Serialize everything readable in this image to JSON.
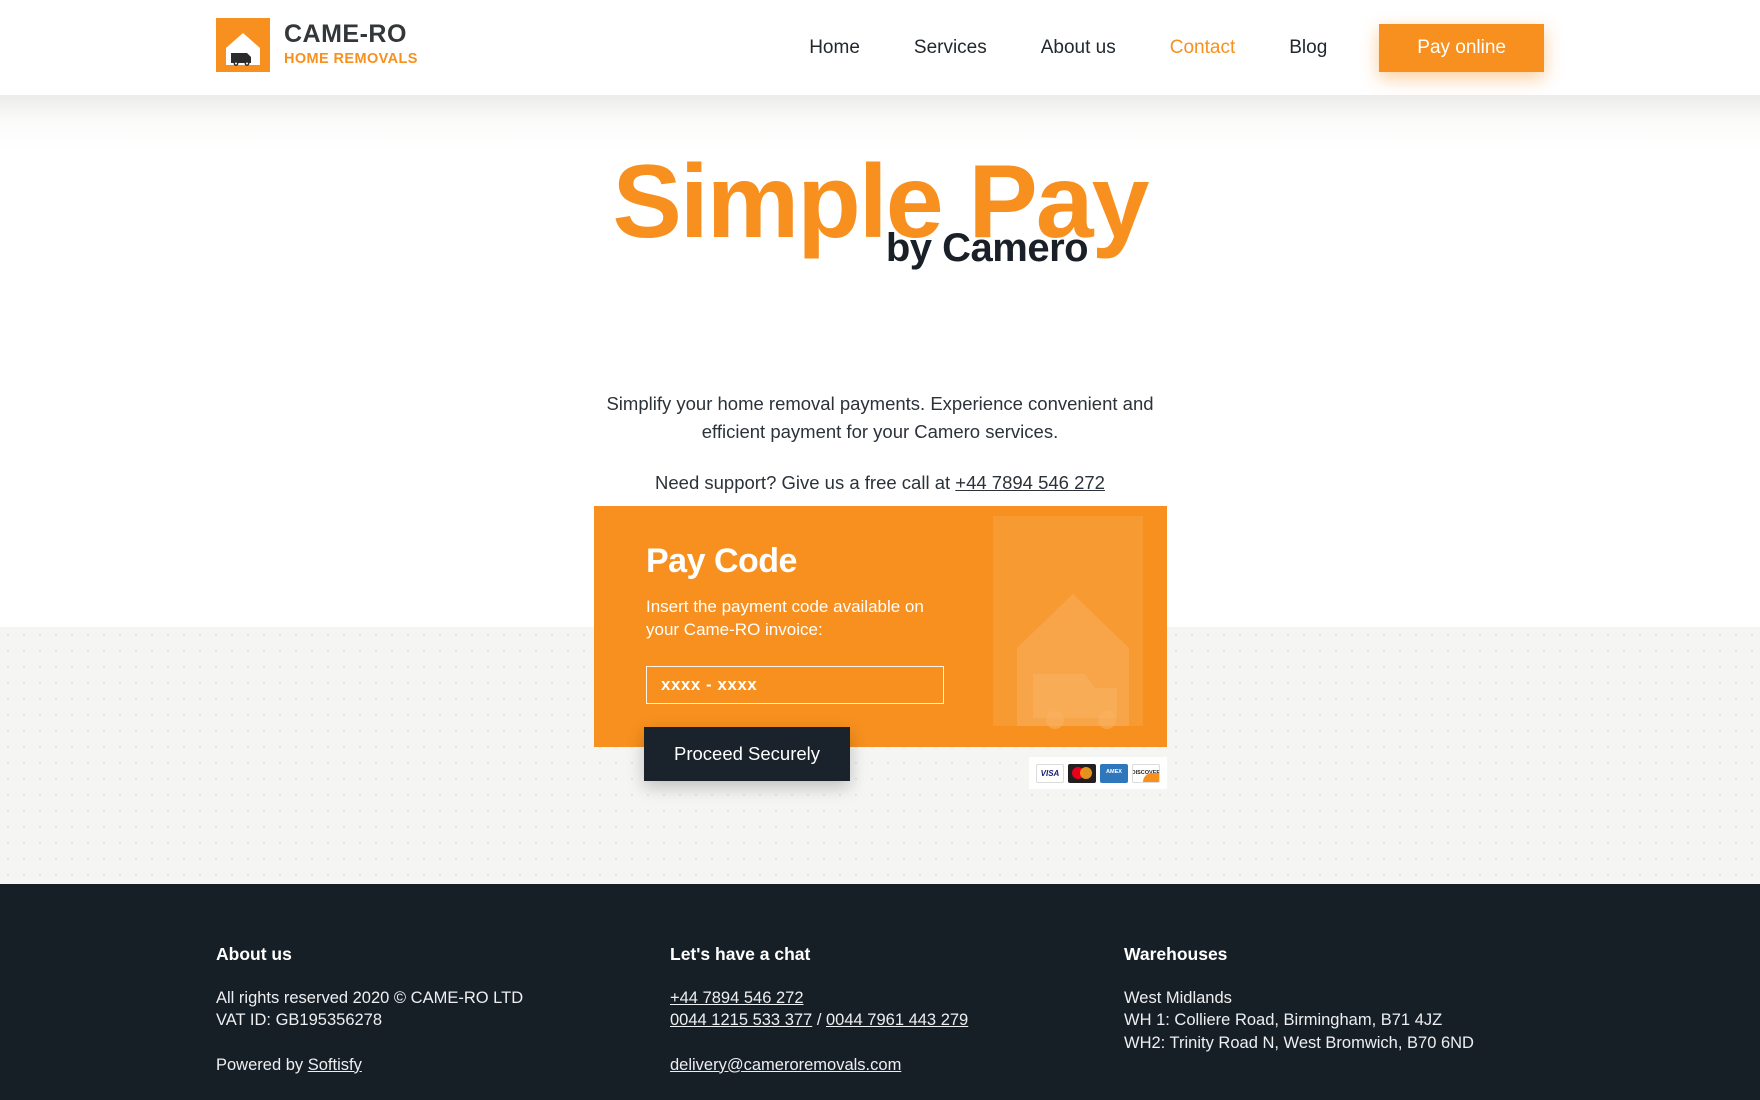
{
  "header": {
    "logo": {
      "icon": "house-truck-logo-icon",
      "name": "CAME-RO",
      "tagline": "HOME REMOVALS"
    },
    "nav": [
      {
        "label": "Home",
        "active": false
      },
      {
        "label": "Services",
        "active": false
      },
      {
        "label": "About us",
        "active": false
      },
      {
        "label": "Contact",
        "active": true
      },
      {
        "label": "Blog",
        "active": false
      }
    ],
    "cta": {
      "label": "Pay online"
    }
  },
  "hero": {
    "title_main": "Simple Pay",
    "title_sub": "by Camero",
    "lead_line1": "Simplify your home removal payments. Experience convenient and",
    "lead_line2": "efficient payment for your Camero services.",
    "support_prefix": "Need support? Give us a free call at ",
    "support_phone": "+44 7894 546 272"
  },
  "pay_card": {
    "title": "Pay Code",
    "description": "Insert the payment code available on your Came-RO invoice:",
    "input_placeholder": "xxxx - xxxx",
    "input_value": "",
    "submit_label": "Proceed Securely",
    "watermark_icon": "house-truck-watermark-icon",
    "accepted_cards": [
      {
        "name": "visa-card-icon",
        "label": "VISA"
      },
      {
        "name": "mastercard-card-icon",
        "label": ""
      },
      {
        "name": "amex-card-icon",
        "label": "AMEX"
      },
      {
        "name": "discover-card-icon",
        "label": "DISCOVER"
      }
    ]
  },
  "footer": {
    "about": {
      "heading": "About us",
      "rights": "All rights reserved 2020 © CAME-RO LTD",
      "vat": "VAT ID: GB195356278",
      "powered_prefix": "Powered by ",
      "powered_link": "Softisfy"
    },
    "chat": {
      "heading": "Let's have a chat",
      "phone_main": "+44 7894 546 272",
      "phone_alt_1": "0044 1215 533 377",
      "phone_separator": " / ",
      "phone_alt_2": "0044 7961 443 279",
      "email": "delivery@cameroremovals.com"
    },
    "warehouses": {
      "heading": "Warehouses",
      "region": "West Midlands",
      "wh1": "WH 1: Colliere Road, Birmingham, B71 4JZ",
      "wh2": "WH2: Trinity Road N, West Bromwich, B70 6ND"
    }
  },
  "colors": {
    "brand_orange": "#F7901E",
    "dark_navy": "#171F26",
    "band_gray": "#f5f5f3"
  }
}
